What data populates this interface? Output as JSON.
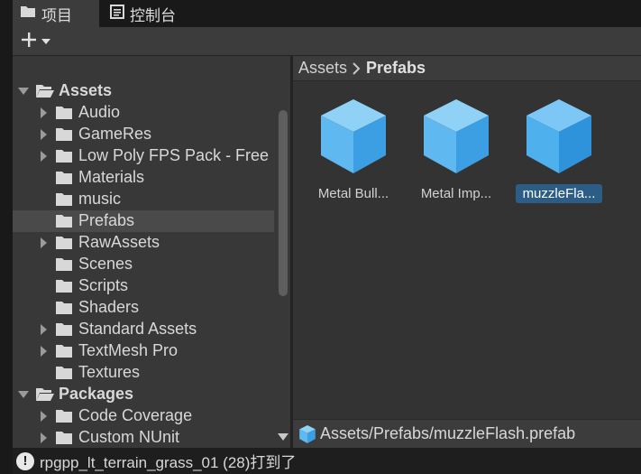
{
  "tabs": [
    {
      "label": "项目",
      "icon": "folder-icon",
      "active": true
    },
    {
      "label": "控制台",
      "icon": "console-icon",
      "active": false
    }
  ],
  "toolbar": {
    "add_icon": "plus-icon"
  },
  "tree": [
    {
      "label": "Assets",
      "level": 0,
      "expandable": true,
      "expanded": true,
      "bold": true
    },
    {
      "label": "Audio",
      "level": 1,
      "expandable": true
    },
    {
      "label": "GameRes",
      "level": 1,
      "expandable": true
    },
    {
      "label": "Low Poly FPS Pack - Free",
      "level": 1,
      "expandable": true
    },
    {
      "label": "Materials",
      "level": 1,
      "expandable": false
    },
    {
      "label": "music",
      "level": 1,
      "expandable": false
    },
    {
      "label": "Prefabs",
      "level": 1,
      "expandable": false,
      "selected": true
    },
    {
      "label": "RawAssets",
      "level": 1,
      "expandable": true
    },
    {
      "label": "Scenes",
      "level": 1,
      "expandable": false
    },
    {
      "label": "Scripts",
      "level": 1,
      "expandable": false
    },
    {
      "label": "Shaders",
      "level": 1,
      "expandable": false
    },
    {
      "label": "Standard Assets",
      "level": 1,
      "expandable": true
    },
    {
      "label": "TextMesh Pro",
      "level": 1,
      "expandable": true
    },
    {
      "label": "Textures",
      "level": 1,
      "expandable": false
    },
    {
      "label": "Packages",
      "level": 0,
      "expandable": true,
      "expanded": true,
      "bold": true
    },
    {
      "label": "Code Coverage",
      "level": 1,
      "expandable": true
    },
    {
      "label": "Custom NUnit",
      "level": 1,
      "expandable": true
    }
  ],
  "breadcrumb": {
    "root": "Assets",
    "current": "Prefabs"
  },
  "assets": [
    {
      "name": "Metal Bull...",
      "selected": false
    },
    {
      "name": "Metal Imp...",
      "selected": false
    },
    {
      "name": "muzzleFla...",
      "selected": true
    }
  ],
  "pathbar": {
    "path": "Assets/Prefabs/muzzleFlash.prefab"
  },
  "status": {
    "message": "rpgpp_lt_terrain_grass_01 (28)打到了"
  },
  "colors": {
    "cube_light": "#8fd2f5",
    "cube_mid": "#5fb8f0",
    "cube_dark": "#3d9fe3",
    "selection": "#2c5d87"
  }
}
